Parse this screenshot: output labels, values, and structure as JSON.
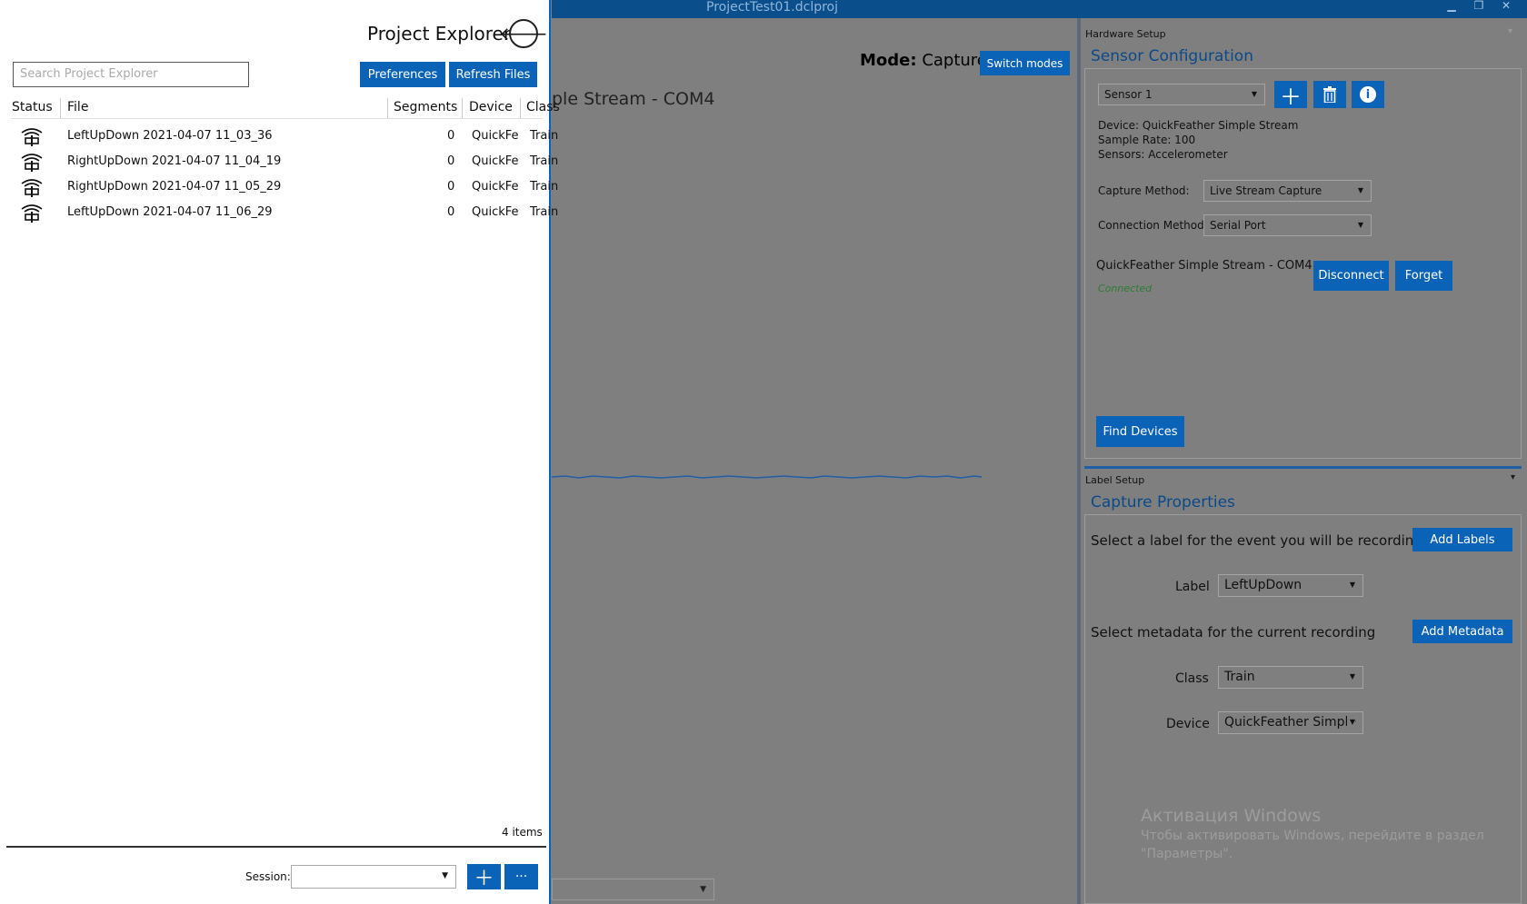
{
  "window": {
    "title": "ProjectTest01.dclproj"
  },
  "capture": {
    "mode_label": "Mode:",
    "mode_value": "Capture",
    "switch_modes": "Switch modes",
    "stream_title": "ple Stream - COM4"
  },
  "hardware": {
    "section": "Hardware Setup",
    "title": "Sensor Configuration",
    "sensor_select": "Sensor 1",
    "device_line": "Device: QuickFeather Simple Stream",
    "sample_rate_line": "Sample Rate: 100",
    "sensors_line": "Sensors: Accelerometer",
    "capture_method_label": "Capture Method:",
    "capture_method_value": "Live Stream Capture",
    "connection_method_label": "Connection Method:",
    "connection_method_value": "Serial Port",
    "device_name": "QuickFeather Simple Stream - COM4",
    "status": "Connected",
    "disconnect": "Disconnect",
    "forget": "Forget",
    "find_devices": "Find Devices"
  },
  "label_setup": {
    "section": "Label Setup",
    "title": "Capture Properties",
    "label_prompt": "Select a label for the event you will be recording",
    "add_labels": "Add Labels",
    "label_label": "Label",
    "label_value": "LeftUpDown",
    "metadata_prompt": "Select metadata for the current recording",
    "add_metadata": "Add Metadata",
    "class_label": "Class",
    "class_value": "Train",
    "device_label": "Device",
    "device_value": "QuickFeather Simple"
  },
  "explorer": {
    "title": "Project Explorer",
    "search_placeholder": "Search Project Explorer",
    "preferences": "Preferences",
    "refresh": "Refresh Files",
    "columns": [
      "Status",
      "File",
      "Segments",
      "Device",
      "Class"
    ],
    "rows": [
      {
        "file": "LeftUpDown 2021-04-07 11_03_36",
        "segments": "0",
        "device": "QuickFe",
        "class": "Train"
      },
      {
        "file": "RightUpDown 2021-04-07 11_04_19",
        "segments": "0",
        "device": "QuickFe",
        "class": "Train"
      },
      {
        "file": "RightUpDown 2021-04-07 11_05_29",
        "segments": "0",
        "device": "QuickFe",
        "class": "Train"
      },
      {
        "file": "LeftUpDown 2021-04-07 11_06_29",
        "segments": "0",
        "device": "QuickFe",
        "class": "Train"
      }
    ],
    "count": "4 items",
    "session_label": "Session:",
    "session_more": "···"
  },
  "watermark": {
    "line1": "Активация Windows",
    "line2": "Чтобы активировать Windows, перейдите в раздел",
    "line3": "\"Параметры\"."
  },
  "colors": {
    "accent": "#0b63b8",
    "status_connected": "#2e7d32"
  }
}
